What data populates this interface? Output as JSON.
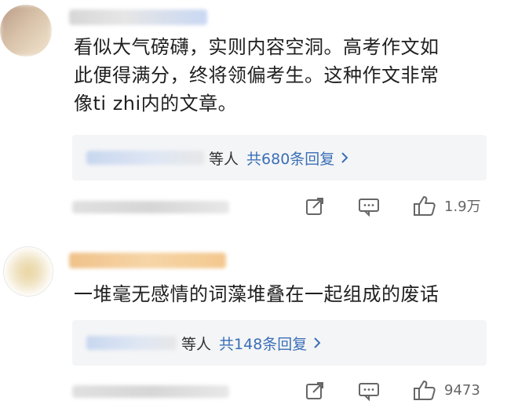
{
  "comments": [
    {
      "text_lines": [
        "看似大气磅礴，实则内容空洞。高考作文如",
        "此便得满分，终将领偏考生。这种作文非常",
        "像ti zhi内的文章。"
      ],
      "replies": {
        "suffix": "等人",
        "count_text": "共680条回复"
      },
      "likes": "1.9万"
    },
    {
      "text_lines": [
        "一堆毫无感情的词藻堆叠在一起组成的废话"
      ],
      "replies": {
        "suffix": "等人",
        "count_text": "共148条回复"
      },
      "likes": "9473"
    }
  ],
  "icons": {
    "share": "share-icon",
    "comment": "comment-icon",
    "like": "thumbs-up-icon",
    "chevron": "chevron-right-icon"
  },
  "colors": {
    "link": "#3b6fb6",
    "reply_bg": "#f4f5f7"
  }
}
